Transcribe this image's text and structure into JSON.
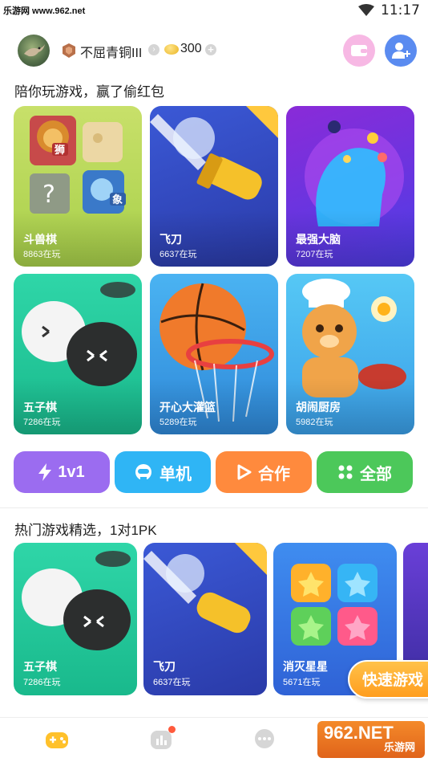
{
  "status_bar": {
    "watermark": "乐游网 www.962.net",
    "time": "11:17"
  },
  "header": {
    "username": "不屈青铜III",
    "coins": "300"
  },
  "section1": {
    "title": "陪你玩游戏，赢了偷红包",
    "games": [
      {
        "name": "斗兽棋",
        "count": "8863在玩",
        "art_label_1": "狮",
        "art_label_2": "象"
      },
      {
        "name": "飞刀",
        "count": "6637在玩"
      },
      {
        "name": "最强大脑",
        "count": "7207在玩"
      },
      {
        "name": "五子棋",
        "count": "7286在玩"
      },
      {
        "name": "开心大灌篮",
        "count": "5289在玩"
      },
      {
        "name": "胡闹厨房",
        "count": "5982在玩"
      }
    ]
  },
  "modes": [
    {
      "label": "1v1",
      "icon": "lightning-icon",
      "color": "#9b6cf0"
    },
    {
      "label": "单机",
      "icon": "robot-icon",
      "color": "#2fb5f5"
    },
    {
      "label": "合作",
      "icon": "play-icon",
      "color": "#ff8a3d"
    },
    {
      "label": "全部",
      "icon": "grid-icon",
      "color": "#4cc85a"
    }
  ],
  "section2": {
    "title": "热门游戏精选，1对1PK",
    "games": [
      {
        "name": "五子棋",
        "count": "7286在玩"
      },
      {
        "name": "飞刀",
        "count": "6637在玩"
      },
      {
        "name": "消灭星星",
        "count": "5671在玩"
      }
    ],
    "quick_play": "快速游戏"
  },
  "watermark_bottom": {
    "line1": "962.NET",
    "line2": "乐游网"
  }
}
